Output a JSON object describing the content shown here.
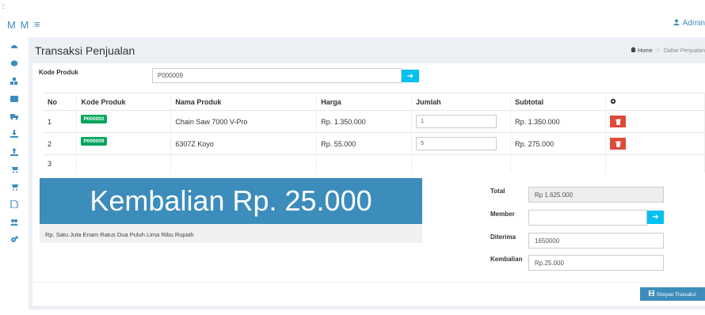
{
  "header": {
    "corner_mark": ":",
    "logo": "M M",
    "menu_icon": "bars-icon",
    "user_name": "Admin"
  },
  "sidebar": {
    "items": [
      {
        "icon": "dashboard-icon"
      },
      {
        "icon": "cube-icon"
      },
      {
        "icon": "cubes-icon"
      },
      {
        "icon": "id-card-icon"
      },
      {
        "icon": "truck-icon"
      },
      {
        "icon": "download-icon"
      },
      {
        "icon": "upload-icon"
      },
      {
        "icon": "cart-icon"
      },
      {
        "icon": "cart-icon"
      },
      {
        "icon": "file-icon"
      },
      {
        "icon": "users-icon"
      },
      {
        "icon": "cogs-icon"
      }
    ]
  },
  "page": {
    "title": "Transaksi Penjualan"
  },
  "breadcrumb": {
    "home": "Home",
    "current": "Daftar Penjualan"
  },
  "kode_produk": {
    "label": "Kode Produk",
    "value": "P000009"
  },
  "table": {
    "headers": {
      "no": "No",
      "kode": "Kode Produk",
      "nama": "Nama Produk",
      "harga": "Harga",
      "jumlah": "Jumlah",
      "subtotal": "Subtotal"
    },
    "rows": [
      {
        "no": "1",
        "kode": "P000002",
        "nama": "Chain Saw 7000 V-Pro",
        "harga": "Rp. 1.350.000",
        "jumlah": "1",
        "subtotal": "Rp. 1.350.000"
      },
      {
        "no": "2",
        "kode": "P000009",
        "nama": "6307Z Koyo",
        "harga": "Rp. 55.000",
        "jumlah": "5",
        "subtotal": "Rp. 275.000"
      },
      {
        "no": "3"
      }
    ]
  },
  "summary": {
    "kembalian_banner": "Kembalian Rp. 25.000",
    "terbilang": "Rp. Satu Juta Enam Ratus Dua Puluh Lima Ribu Rupiah",
    "total_label": "Total",
    "total_value": "Rp 1.625.000",
    "member_label": "Member",
    "member_value": "",
    "diterima_label": "Diterima",
    "diterima_value": "1650000",
    "kembalian_label": "Kembalian",
    "kembalian_value": "Rp.25.000"
  },
  "actions": {
    "save_label": "Simpan Transaksi"
  },
  "colors": {
    "primary": "#3c8dbc",
    "info": "#00c0ef",
    "success": "#00a65a",
    "danger": "#dd4b39",
    "content_bg": "#ecf0f5"
  }
}
